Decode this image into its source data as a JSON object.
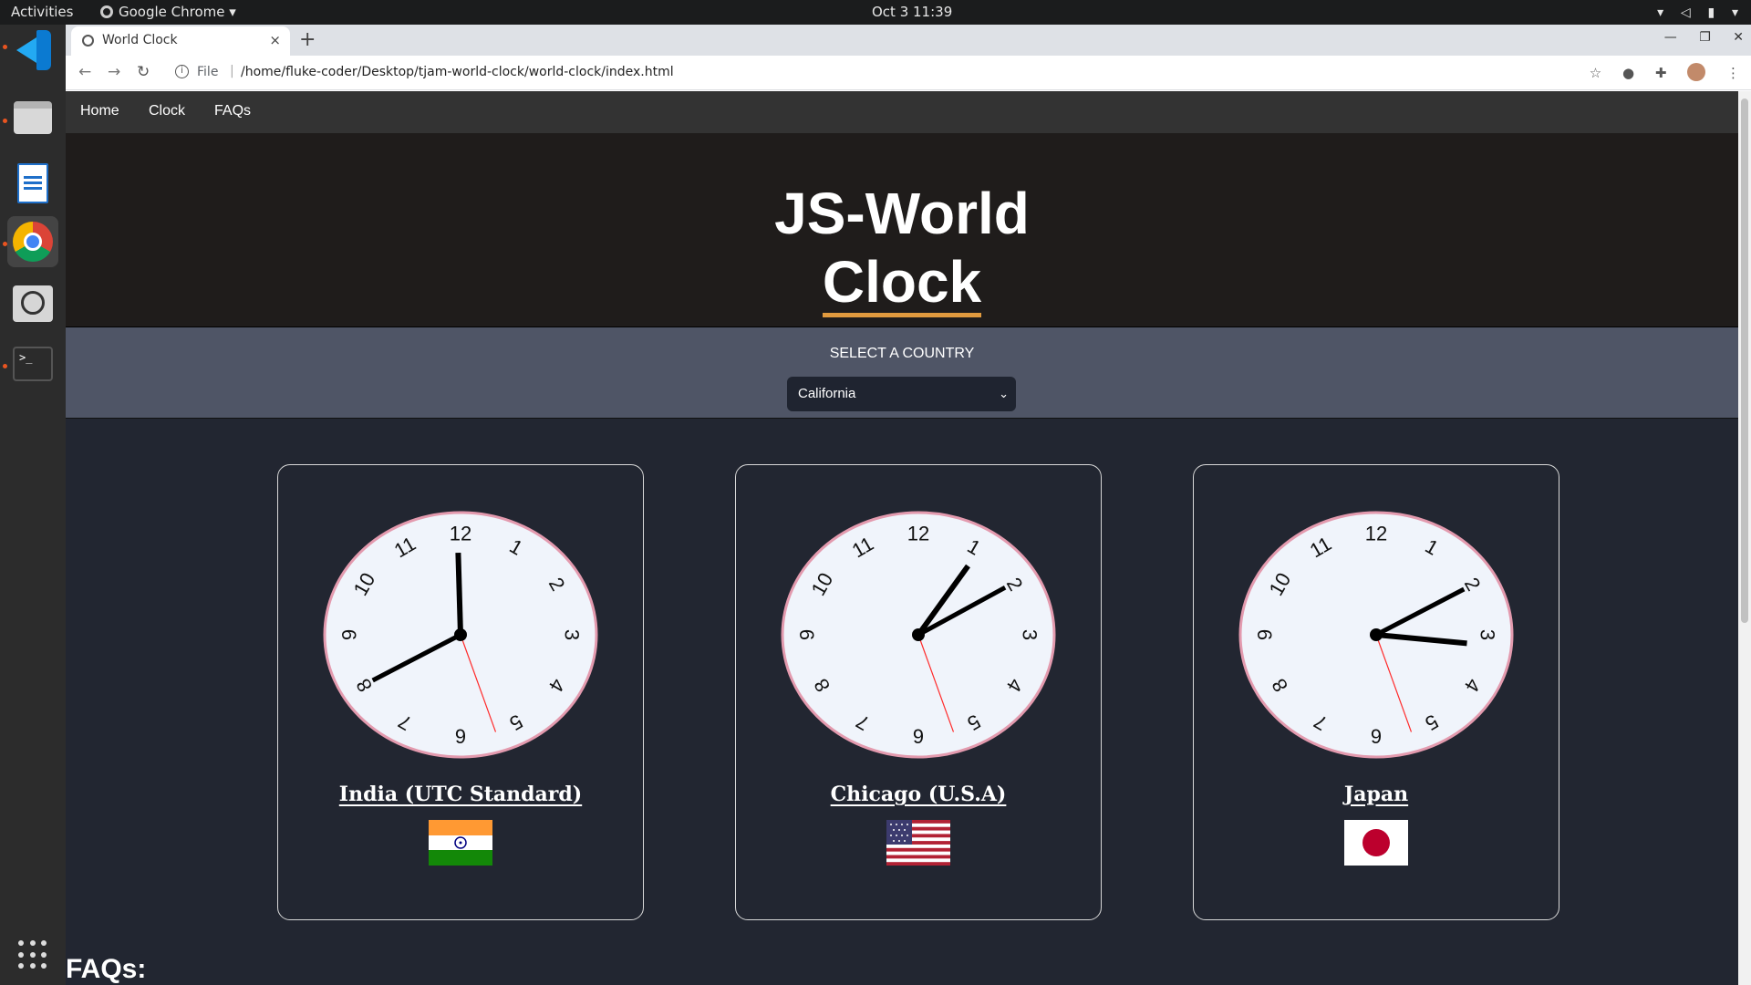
{
  "system": {
    "activities": "Activities",
    "app_name": "Google Chrome",
    "app_caret": "▾",
    "datetime": "Oct 3  11:39"
  },
  "browser": {
    "tab_title": "World Clock",
    "tab_close": "×",
    "new_tab": "+",
    "url_scheme": "File",
    "url_separator": "|",
    "url": "/home/fluke-coder/Desktop/tjam-world-clock/world-clock/index.html"
  },
  "site": {
    "nav": [
      "Home",
      "Clock",
      "FAQs"
    ],
    "title_line1": "JS-World",
    "title_line2": "Clock",
    "select_label": "SELECT A COUNTRY",
    "selected_country": "California",
    "faqs_heading": "FAQs:"
  },
  "clocks": [
    {
      "city": "India (UTC Standard)",
      "flag": "india-flag",
      "time": {
        "hour": 11.95,
        "minute": 40,
        "second": 27
      }
    },
    {
      "city": "Chicago (U.S.A)",
      "flag": "usa-flag",
      "time": {
        "hour": 1.1,
        "minute": 9.8,
        "second": 27
      }
    },
    {
      "city": "Japan",
      "flag": "japan-flag",
      "time": {
        "hour": 3.2,
        "minute": 10,
        "second": 27
      }
    }
  ],
  "dial_numbers": [
    "12",
    "1",
    "2",
    "3",
    "4",
    "5",
    "6",
    "7",
    "8",
    "9",
    "10",
    "11"
  ],
  "colors": {
    "page_bg": "#222631",
    "hero_bg": "#1f1c1b",
    "selector_bg": "#4f5566",
    "accent_underline": "#e19a3e",
    "clock_face": "#f0f4fb",
    "clock_rim": "#e39aae",
    "second_hand": "#ff2a2a"
  }
}
